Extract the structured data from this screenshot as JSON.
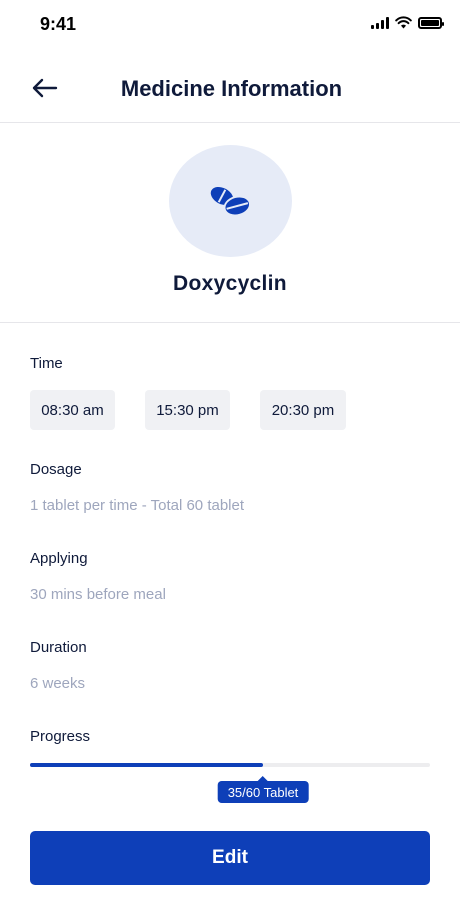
{
  "status_bar": {
    "time": "9:41"
  },
  "header": {
    "title": "Medicine Information"
  },
  "medicine": {
    "name": "Doxycyclin",
    "icon": "pills-icon"
  },
  "time_section": {
    "label": "Time",
    "slots": [
      "08:30 am",
      "15:30 pm",
      "20:30 pm"
    ]
  },
  "dosage": {
    "label": "Dosage",
    "value": "1 tablet per time - Total 60 tablet"
  },
  "applying": {
    "label": "Applying",
    "value": "30 mins before meal"
  },
  "duration": {
    "label": "Duration",
    "value": "6 weeks"
  },
  "progress": {
    "label": "Progress",
    "taken": 35,
    "total": 60,
    "text": "35/60 Tablet"
  },
  "actions": {
    "edit_label": "Edit"
  },
  "colors": {
    "accent": "#0e3fb8",
    "muted_text": "#9ea6bd",
    "icon_bg": "#e6ebf7",
    "chip_bg": "#f0f1f4"
  }
}
